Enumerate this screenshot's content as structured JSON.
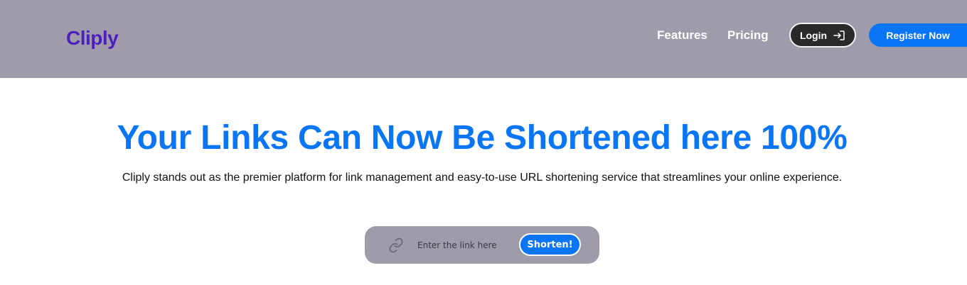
{
  "header": {
    "logo": "Cliply",
    "nav": {
      "features": "Features",
      "pricing": "Pricing"
    },
    "login_label": "Login",
    "register_label": "Register Now"
  },
  "hero": {
    "title": "Your Links Can Now Be Shortened here 100%",
    "subtitle": "Cliply stands out as the premier platform for link management and easy-to-use URL shortening service that streamlines your online experience."
  },
  "shortener": {
    "placeholder": "Enter the link here",
    "value": "",
    "button_label": "Shorten!"
  },
  "icons": {
    "login": "login-arrow-icon",
    "link": "link-icon"
  },
  "colors": {
    "header_bg": "#9f9baa",
    "logo": "#4c1fbf",
    "accent": "#0a75f5",
    "login_bg": "#2a2828"
  }
}
